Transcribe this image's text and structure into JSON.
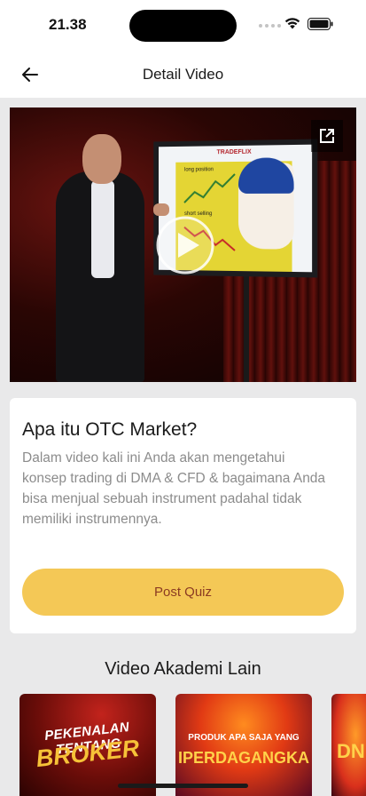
{
  "status_bar": {
    "time": "21.38",
    "icons": [
      "signal-dots-icon",
      "wifi-icon",
      "battery-icon"
    ]
  },
  "header": {
    "title": "Detail Video",
    "back_icon": "arrow-left-icon"
  },
  "video": {
    "screen_brand": "TRADEFLIX",
    "screen_labels": [
      "long position",
      "short selling"
    ],
    "play_icon": "play-circle-icon",
    "open_icon": "open-external-icon"
  },
  "card": {
    "title": "Apa itu OTC Market?",
    "description": "Dalam video kali ini Anda akan mengetahui konsep trading di DMA & CFD & bagaimana Anda bisa menjual sebuah instrument padahal tidak memiliki instrumennya.",
    "quiz_button": "Post Quiz"
  },
  "other_videos": {
    "title": "Video Akademi Lain",
    "items": [
      {
        "line1": "PEKENALAN TENTANG",
        "line2": "BROKER"
      },
      {
        "line1": "PRODUK APA SAJA YANG",
        "line2": "IPERDAGANGKA"
      },
      {
        "line1": "",
        "line2": "DN"
      }
    ]
  },
  "colors": {
    "accent": "#f4c856",
    "accent_text": "#8b3b22",
    "background": "#e9e9ea"
  }
}
